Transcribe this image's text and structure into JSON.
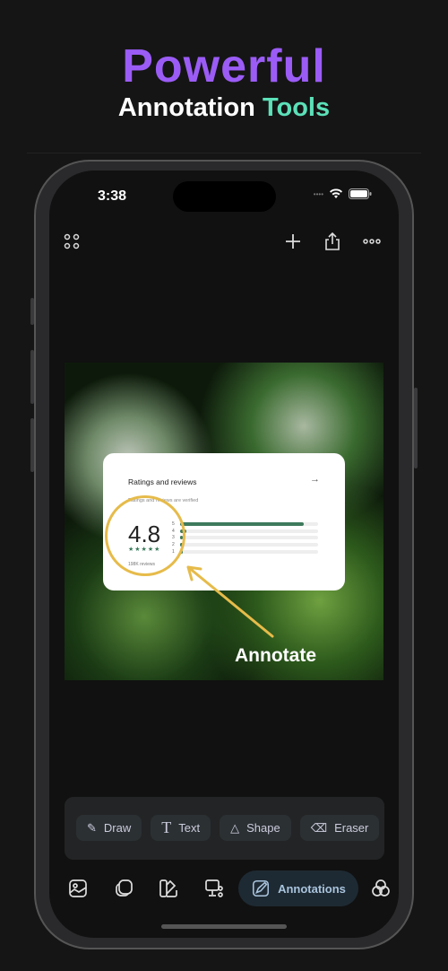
{
  "headline": {
    "line1": "Powerful",
    "line2_a": "Annotation",
    "line2_b": "Tools"
  },
  "status": {
    "time": "3:38"
  },
  "toolbar": {
    "menu_icon": "grid-dots-icon",
    "add_icon": "plus-icon",
    "share_icon": "share-icon",
    "more_icon": "ellipsis-icon"
  },
  "card": {
    "title": "Ratings and reviews",
    "verified": "Ratings and reviews are verified",
    "rating": "4.8",
    "stars": "★★★★★",
    "reviews": "198K reviews",
    "bars": [
      {
        "label": "5",
        "fill": 0.9
      },
      {
        "label": "4",
        "fill": 0.05
      },
      {
        "label": "3",
        "fill": 0.01
      },
      {
        "label": "2",
        "fill": 0.01
      },
      {
        "label": "1",
        "fill": 0.01
      }
    ]
  },
  "annotation_label": "Annotate",
  "annotation_color": "#e6bb4a",
  "tools": [
    {
      "label": "Draw",
      "icon": "draw-icon"
    },
    {
      "label": "Text",
      "icon": "text-icon"
    },
    {
      "label": "Shape",
      "icon": "shape-icon"
    },
    {
      "label": "Eraser",
      "icon": "eraser-icon"
    }
  ],
  "nav": {
    "active_label": "Annotations",
    "items": [
      "image-icon",
      "layers-icon",
      "palette-icon",
      "device-settings-icon",
      "annotations-icon",
      "blend-icon"
    ]
  }
}
